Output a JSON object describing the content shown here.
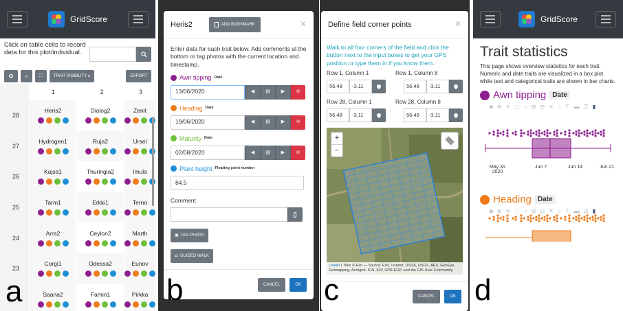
{
  "app": {
    "name": "GridScore"
  },
  "labels": {
    "a": "a",
    "b": "b",
    "c": "c",
    "d": "d"
  },
  "colors": {
    "purple": "#8e1f8e",
    "orange": "#ef7b1a",
    "green": "#6fbf3a",
    "blue": "#1e8fd6"
  },
  "panel_a": {
    "intro": "Click on table cells to record data for this plot/individual.",
    "toolbar": {
      "trait_visibility": "TRAIT VISIBILITY",
      "export": "EXPORT"
    },
    "columns": [
      "1",
      "2",
      "3"
    ],
    "rows": [
      {
        "num": "28",
        "cells": [
          "Heris2",
          "Dialog2",
          "Zenit"
        ]
      },
      {
        "num": "27",
        "cells": [
          "Hydrogen1",
          "Ruja2",
          "Ursel"
        ]
      },
      {
        "num": "26",
        "cells": [
          "Kajsa1",
          "Thuringia2",
          "Imula"
        ]
      },
      {
        "num": "25",
        "cells": [
          "Tarm1",
          "Erkki1",
          "Terno"
        ]
      },
      {
        "num": "24",
        "cells": [
          "Arra2",
          "Ceylon2",
          "Marth"
        ]
      },
      {
        "num": "23",
        "cells": [
          "Corgi1",
          "Odessa2",
          "Eunov"
        ]
      },
      {
        "num": "",
        "cells": [
          "Saana2",
          "Famin1",
          "Pirkka"
        ]
      }
    ]
  },
  "panel_b": {
    "title": "Heris2",
    "bookmark": "ADD BOOKMARK",
    "intro": "Enter data for each trait below. Add comments at the bottom or tag photos with the current location and timestamp.",
    "traits": [
      {
        "name": "Awn tipping",
        "type": "Date",
        "value": "13/06/2020"
      },
      {
        "name": "Heading",
        "type": "Date",
        "value": "19/06/2020"
      },
      {
        "name": "Maturity",
        "type": "Date",
        "value": "02/08/2020"
      },
      {
        "name": "Plant height",
        "type": "Floating point number",
        "value": "84.5"
      }
    ],
    "comment_label": "Comment",
    "tag_photo": "TAG PHOTO",
    "guided_walk": "GUIDED WALK",
    "cancel": "CANCEL",
    "ok": "OK"
  },
  "panel_c": {
    "title": "Define field corner points",
    "intro": "Walk to all four corners of the field and click the button next to the input boxes to get your GPS position or type them in if you know them.",
    "corners": [
      {
        "label": "Row 1, Column 1",
        "lat": "56.48",
        "lng": "-3.11"
      },
      {
        "label": "Row 1, Column 8",
        "lat": "56.48",
        "lng": "-3.11"
      },
      {
        "label": "Row 28, Column 1",
        "lat": "56.48",
        "lng": "-3.11"
      },
      {
        "label": "Row 28, Column 8",
        "lat": "56.48",
        "lng": "-3.11"
      }
    ],
    "attribution_link": "Leaflet",
    "attribution": " | Tiles © Esri — Source: Esri, i-cubed, USDA, USGS, AEX, GeoEye, Getmapping, Aerogrid, IGN, IGP, UPR-EGP, and the GIS User Community",
    "zoom_in": "+",
    "zoom_out": "−",
    "cancel": "CANCEL",
    "ok": "OK"
  },
  "panel_d": {
    "title": "Trait statistics",
    "description": "This page shows overview statistics for each trait. Numeric and date traits are visualized in a box plot while text and categorical traits are shown in bar charts.",
    "traits": [
      {
        "name": "Awn tipping",
        "type": "Date"
      },
      {
        "name": "Heading",
        "type": "Date"
      }
    ],
    "x_ticks": [
      {
        "line1": "May 31",
        "line2": "2020"
      },
      {
        "line1": "Jun 7",
        "line2": ""
      },
      {
        "line1": "Jun 14",
        "line2": ""
      },
      {
        "line1": "Jun 21",
        "line2": ""
      }
    ]
  }
}
